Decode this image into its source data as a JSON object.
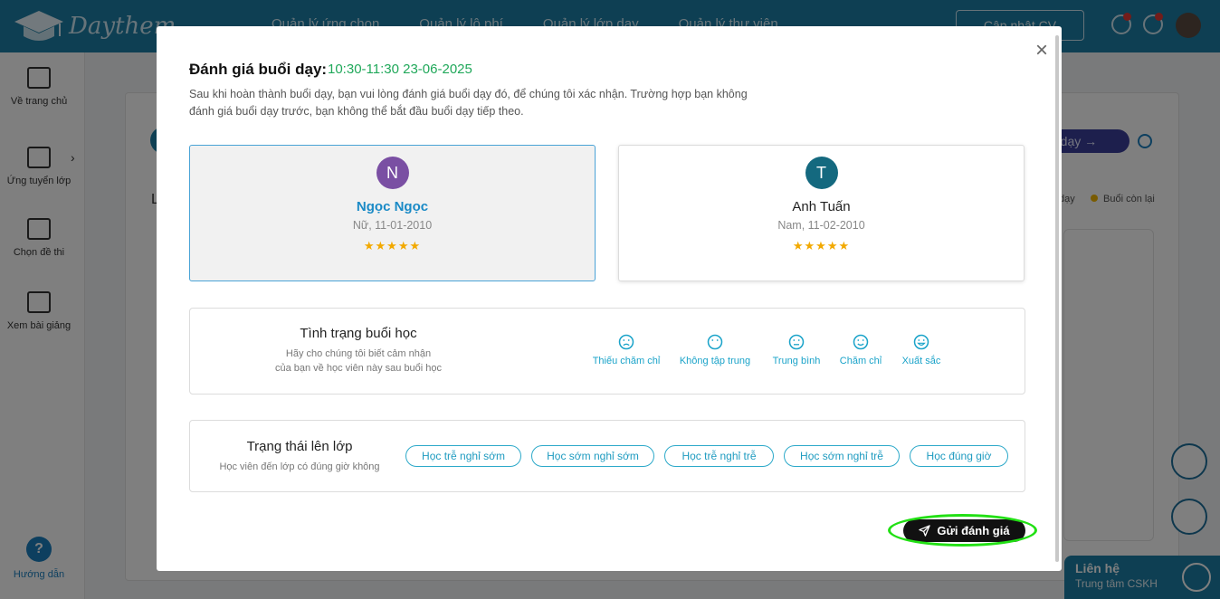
{
  "app": {
    "logo_text": "Daythem",
    "nav": [
      "Quản lý ứng chọn",
      "Quản lý lộ phí",
      "Quản lý lớp dạy",
      "Quản lý thư viện"
    ],
    "update_cv": "Cập nhật CV"
  },
  "sidebar": {
    "items": [
      {
        "label": "Về trang chủ"
      },
      {
        "label": "Ứng tuyển lớp"
      },
      {
        "label": "Chọn đề thi"
      },
      {
        "label": "Xem bài giảng"
      }
    ],
    "help_label": "Hướng dẫn"
  },
  "background": {
    "pill_label": "u dạy",
    "legend_1": "dạy",
    "legend_2": "Buổi còn lại",
    "L": "L"
  },
  "contact": {
    "title": "Liên hệ",
    "subtitle": "Trung tâm CSKH"
  },
  "modal": {
    "close": "×",
    "title": "Đánh giá buổi dạy:",
    "time": "10:30-11:30 23-06-2025",
    "description": "Sau khi hoàn thành buổi dạy, bạn vui lòng đánh giá buổi dạy đó, để chúng tôi xác nhận. Trường hợp bạn không đánh giá buổi dạy trước, bạn không thể bắt đầu buổi dạy tiếp theo.",
    "students": [
      {
        "initial": "N",
        "name": "Ngọc Ngọc",
        "info": "Nữ, 11-01-2010",
        "stars": "★★★★★"
      },
      {
        "initial": "T",
        "name": "Anh Tuấn",
        "info": "Nam, 11-02-2010",
        "stars": "★★★★★"
      }
    ],
    "status_panel": {
      "title": "Tình trạng buổi học",
      "subtitle_1": "Hãy cho chúng tôi biết cảm nhận",
      "subtitle_2": "của bạn về học viên này sau buổi học",
      "options": [
        "Thiếu chăm chỉ",
        "Không tập trung",
        "Trung bình",
        "Chăm chỉ",
        "Xuất sắc"
      ]
    },
    "attendance_panel": {
      "title": "Trạng thái lên lớp",
      "subtitle": "Học viên đến lớp có đúng giờ không",
      "options": [
        "Học trễ nghỉ sớm",
        "Học sớm nghỉ sớm",
        "Học trễ nghỉ trễ",
        "Học sớm nghỉ trễ",
        "Học đúng giờ"
      ]
    },
    "submit_label": "Gửi đánh giá"
  },
  "colors": {
    "accent": "#1d7fa6",
    "time_green": "#20a85a",
    "highlight": "#22e014",
    "star": "#f2a900",
    "chip": "#2ca9c9"
  }
}
